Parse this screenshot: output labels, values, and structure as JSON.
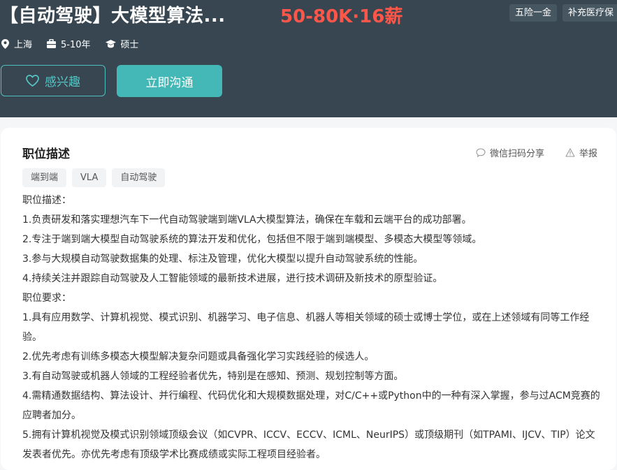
{
  "header": {
    "title": "【自动驾驶】大模型算法...",
    "salary": "50-80K·16薪",
    "benefits": [
      "五险一金",
      "补充医疗保"
    ],
    "meta": {
      "city": "上海",
      "experience": "5-10年",
      "education": "硕士",
      "city_icon": "location-pin-icon",
      "experience_icon": "briefcase-icon",
      "education_icon": "graduation-cap-icon"
    },
    "interest_label": "感兴趣",
    "chat_label": "立即沟通"
  },
  "colors": {
    "header_bg": "#374650",
    "salary": "#fe574a",
    "accent": "#44b8b7"
  },
  "card": {
    "title": "职位描述",
    "share_label": "微信扫码分享",
    "report_label": "举报",
    "tags": [
      "端到端",
      "VLA",
      "自动驾驶"
    ],
    "description": [
      "职位描述：",
      "1.负责研发和落实理想汽车下一代自动驾驶端到端VLA大模型算法，确保在车载和云端平台的成功部署。",
      "2.专注于端到端大模型自动驾驶系统的算法开发和优化，包括但不限于端到端模型、多模态大模型等领域。",
      "3.参与大规模自动驾驶数据集的处理、标注及管理，优化大模型以提升自动驾驶系统的性能。",
      "4.持续关注并跟踪自动驾驶及人工智能领域的最新技术进展，进行技术调研及新技术的原型验证。",
      "职位要求：",
      "1.具有应用数学、计算机视觉、模式识别、机器学习、电子信息、机器人等相关领域的硕士或博士学位，或在上述领域有同等工作经验。",
      "2.优先考虑有训练多模态大模型解决复杂问题或具备强化学习实践经验的候选人。",
      "3.有自动驾驶或机器人领域的工程经验者优先，特别是在感知、预测、规划控制等方面。",
      "4.需精通数据结构、算法设计、并行编程、代码优化和大规模数据处理，对C/C++或Python中的一种有深入掌握，参与过ACM竞赛的应聘者加分。",
      "5.拥有计算机视觉及模式识别领域顶级会议（如CVPR、ICCV、ECCV、ICML、NeurIPS）或顶级期刊（如TPAMI、IJCV、TIP）论文发表者优先。亦优先考虑有顶级学术比赛成绩或实际工程项目经验者。"
    ]
  }
}
